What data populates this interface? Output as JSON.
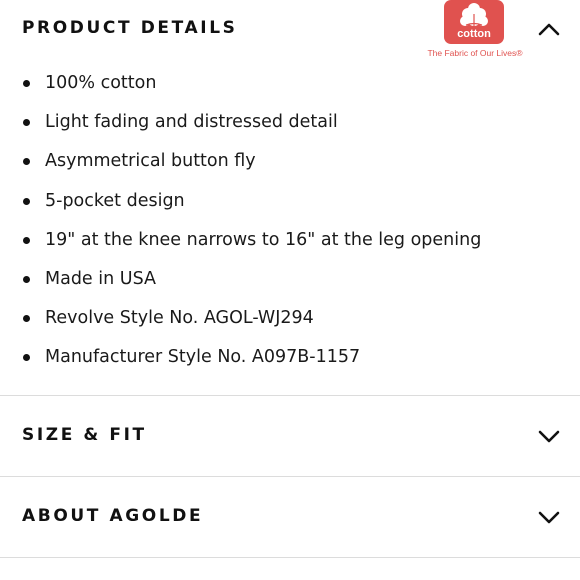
{
  "sections": {
    "product_details": {
      "title": "PRODUCT DETAILS",
      "state": "expanded",
      "items": [
        "100% cotton",
        "Light fading and distressed detail",
        "Asymmetrical button fly",
        "5-pocket design",
        "19\" at the knee narrows to 16\" at the leg opening",
        "Made in USA",
        "Revolve Style No. AGOL-WJ294",
        "Manufacturer Style No. A097B-1157"
      ]
    },
    "size_fit": {
      "title": "SIZE & FIT",
      "state": "collapsed"
    },
    "about": {
      "title": "ABOUT AGOLDE",
      "state": "collapsed"
    }
  },
  "cotton_logo": {
    "wordmark": "cotton",
    "tagline": "The Fabric of Our Lives®",
    "color": "#e0524f"
  },
  "icons": {
    "expanded": "chevron-up-icon",
    "collapsed": "chevron-down-icon"
  }
}
